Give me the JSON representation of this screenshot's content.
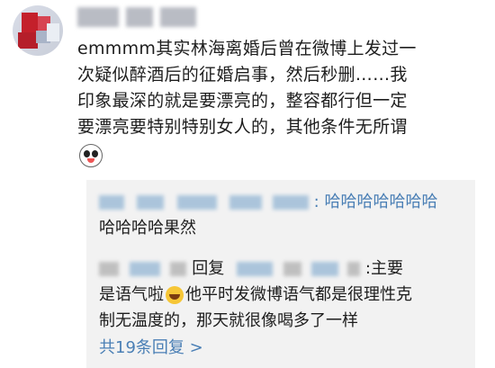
{
  "comment": {
    "text_lines": [
      "emmmm其实林海离婚后曾在微博上发过一",
      "次疑似醉酒后的征婚启事，然后秒删……我",
      "印象最深的就是要漂亮的，整容都行但一定",
      "要漂亮要特别特别女人的，其他条件无所谓"
    ],
    "emoji_icon": "panda-face-icon"
  },
  "replies": [
    {
      "suffix": ": 哈哈哈哈哈哈哈",
      "line2": "哈哈哈哈果然"
    },
    {
      "reply_word": "回复",
      "suffix": ":主要",
      "line2_a": "是语气啦",
      "emoji_icon": "laughing-face-icon",
      "line2_b": "他平时发微博语气都是很理性克",
      "line3": "制无温度的，那天就很像喝多了一样"
    }
  ],
  "more_replies_label": "共19条回复 >",
  "colors": {
    "link": "#4a7fb5",
    "reply_bg": "#f2f2f2",
    "text": "#1e1e1e"
  }
}
